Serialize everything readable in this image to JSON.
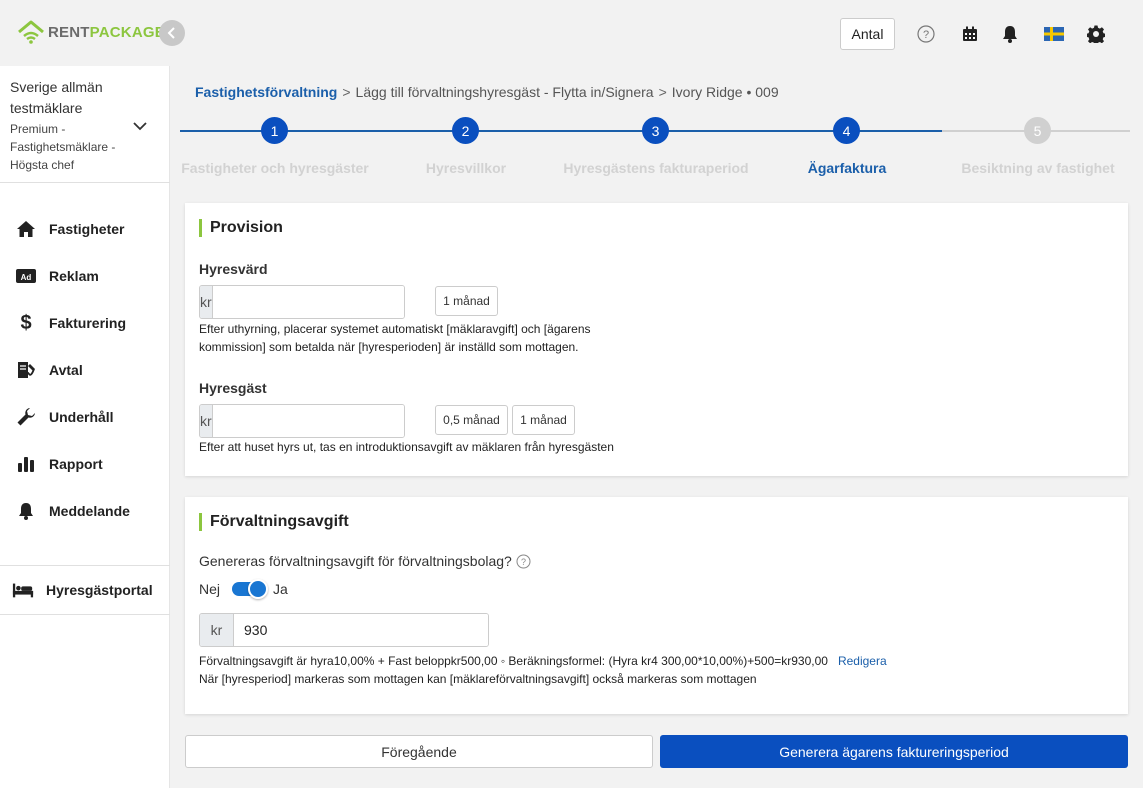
{
  "brand": {
    "part1": "RENT",
    "part2": "PACKAGE",
    "green": "#8cc63f",
    "blue": "#0a4fbf"
  },
  "topbar": {
    "antal_label": "Antal",
    "icons": [
      "help-icon",
      "calendar-icon",
      "bell-icon",
      "swedish-flag-icon",
      "gear-icon"
    ]
  },
  "account": {
    "name": "Sverige allmän testmäklare",
    "role": "Premium - Fastighetsmäklare - Högsta chef"
  },
  "sidebar": {
    "items": [
      {
        "label": "Fastigheter",
        "icon": "home-icon"
      },
      {
        "label": "Reklam",
        "icon": "ad-icon"
      },
      {
        "label": "Fakturering",
        "icon": "dollar-icon"
      },
      {
        "label": "Avtal",
        "icon": "contract-icon"
      },
      {
        "label": "Underhåll",
        "icon": "wrench-icon"
      },
      {
        "label": "Rapport",
        "icon": "bar-chart-icon"
      },
      {
        "label": "Meddelande",
        "icon": "bell-icon"
      }
    ],
    "portal_label": "Hyresgästportal"
  },
  "breadcrumb": {
    "root": "Fastighetsförvaltning",
    "sep": ">",
    "step2": "Lägg till förvaltningshyresgäst - Flytta in/Signera",
    "step3": "Ivory Ridge • 009"
  },
  "stepper": {
    "steps": [
      {
        "num": "1",
        "label": "Fastigheter och hyresgäster"
      },
      {
        "num": "2",
        "label": "Hyresvillkor"
      },
      {
        "num": "3",
        "label": "Hyresgästens fakturaperiod"
      },
      {
        "num": "4",
        "label": "Ägarfaktura"
      },
      {
        "num": "5",
        "label": "Besiktning av fastighet"
      }
    ],
    "active": 4
  },
  "provision": {
    "title": "Provision",
    "landlord": {
      "label": "Hyresvärd",
      "prefix": "kr",
      "value": "",
      "chips": [
        "1 månad"
      ],
      "hint_line1": "Efter uthyrning, placerar systemet automatiskt [mäklaravgift] och [ägarens",
      "hint_line2": "kommission] som betalda när [hyresperioden] är inställd som mottagen."
    },
    "tenant": {
      "label": "Hyresgäst",
      "prefix": "kr",
      "value": "",
      "chips": [
        "0,5 månad",
        "1 månad"
      ],
      "hint": "Efter att huset hyrs ut, tas en introduktionsavgift av mäklaren från hyresgästen"
    }
  },
  "management_fee": {
    "title": "Förvaltningsavgift",
    "question": "Genereras förvaltningsavgift för förvaltningsbolag?",
    "toggle_off": "Nej",
    "toggle_on": "Ja",
    "toggle_state": "on",
    "prefix": "kr",
    "value": "930",
    "formula": "Förvaltningsavgift är hyra10,00% + Fast beloppkr500,00 ◦ Beräkningsformel: (Hyra kr4 300,00*10,00%)+500=kr930,00",
    "edit_link": "Redigera",
    "note": "När [hyresperiod] markeras som mottagen kan [mäklareförvaltningsavgift] också markeras som mottagen"
  },
  "actions": {
    "prev": "Föregående",
    "generate": "Generera ägarens faktureringsperiod"
  }
}
